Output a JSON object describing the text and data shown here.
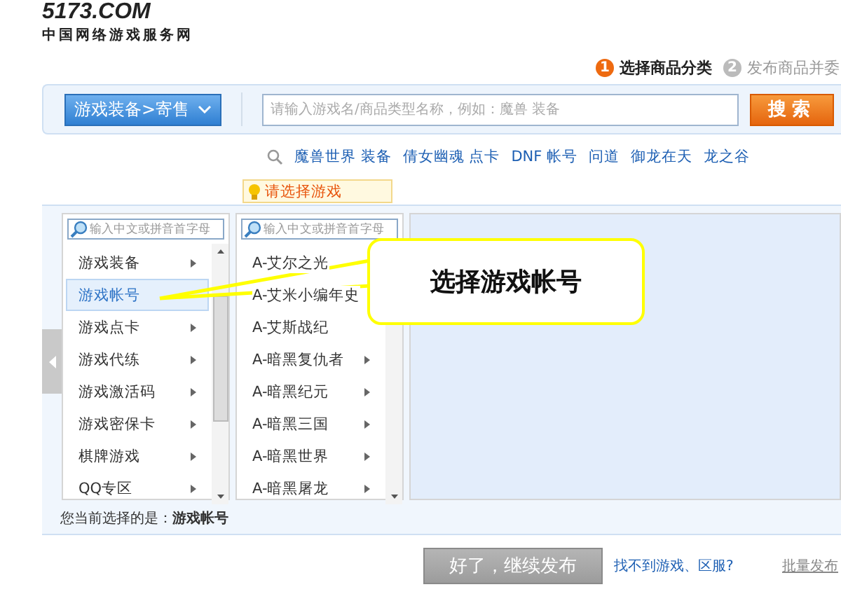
{
  "logo": {
    "text": "5173.COM",
    "tagline": "中国网络游戏服务网"
  },
  "steps": [
    {
      "number": "1",
      "label": "选择商品分类",
      "selected": true
    },
    {
      "number": "2",
      "label": "发布商品并委",
      "selected": false
    }
  ],
  "search": {
    "category": "游戏装备>寄售",
    "placeholder": "请输入游戏名/商品类型名称，例如：魔兽 装备",
    "button": "搜索"
  },
  "hot_links": [
    "魔兽世界 装备",
    "倩女幽魂 点卡",
    "DNF 帐号",
    "问道",
    "御龙在天",
    "龙之谷"
  ],
  "tooltip": "请选择游戏",
  "columns": [
    {
      "placeholder": "输入中文或拼音首字母",
      "items": [
        {
          "label": "游戏装备",
          "selected": false,
          "has_children": true
        },
        {
          "label": "游戏帐号",
          "selected": true,
          "has_children": false
        },
        {
          "label": "游戏点卡",
          "selected": false,
          "has_children": true
        },
        {
          "label": "游戏代练",
          "selected": false,
          "has_children": true
        },
        {
          "label": "游戏激活码",
          "selected": false,
          "has_children": true
        },
        {
          "label": "游戏密保卡",
          "selected": false,
          "has_children": true
        },
        {
          "label": "棋牌游戏",
          "selected": false,
          "has_children": true
        },
        {
          "label": "QQ专区",
          "selected": false,
          "has_children": true
        }
      ]
    },
    {
      "placeholder": "输入中文或拼音首字母",
      "items": [
        {
          "label": "A-艾尔之光",
          "selected": false,
          "has_children": false
        },
        {
          "label": "A-艾米小编年史",
          "selected": false,
          "has_children": false
        },
        {
          "label": "A-艾斯战纪",
          "selected": false,
          "has_children": false
        },
        {
          "label": "A-暗黑复仇者",
          "selected": false,
          "has_children": true
        },
        {
          "label": "A-暗黑纪元",
          "selected": false,
          "has_children": true
        },
        {
          "label": "A-暗黑三国",
          "selected": false,
          "has_children": true
        },
        {
          "label": "A-暗黑世界",
          "selected": false,
          "has_children": true
        },
        {
          "label": "A-暗黑屠龙",
          "selected": false,
          "has_children": true
        }
      ]
    }
  ],
  "callout": "选择游戏帐号",
  "current_selection": {
    "label": "您当前选择的是：",
    "value": "游戏帐号"
  },
  "continue_button": "好了，继续发布",
  "help_link": "找不到游戏、区服?",
  "batch_link": "批量发布"
}
